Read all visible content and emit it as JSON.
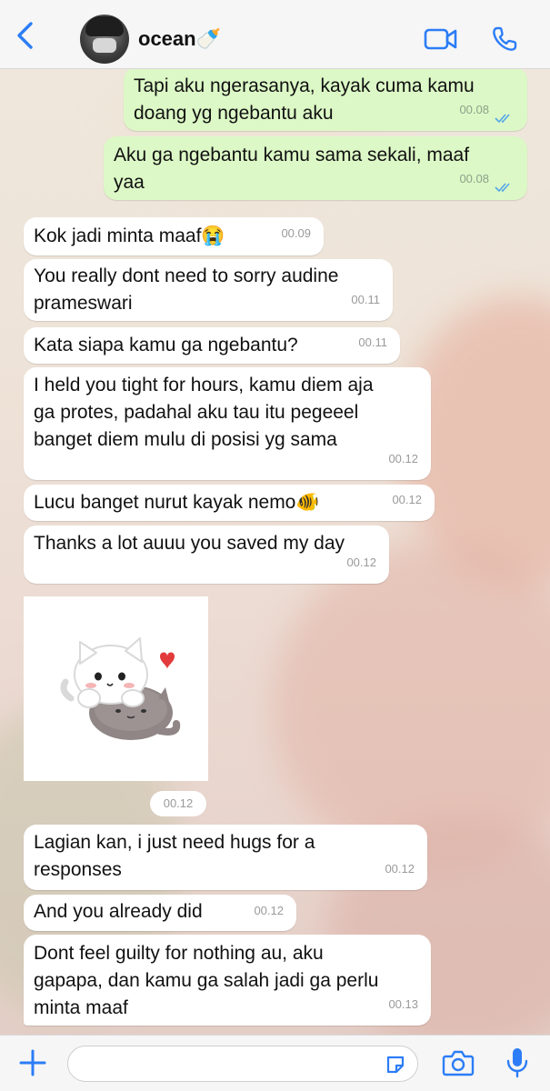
{
  "header": {
    "contact_name": "ocean🍼",
    "avatar": "profile-photo",
    "accent_color": "#2c7df6"
  },
  "messages": [
    {
      "dir": "out",
      "text_lines": [
        "Tapi aku ngerasanya, kayak cuma kamu",
        "doang yg ngebantu aku"
      ],
      "time": "00.08",
      "read": true
    },
    {
      "dir": "out",
      "text_lines": [
        "Aku ga ngebantu kamu sama sekali, maaf",
        "yaa"
      ],
      "time": "00.08",
      "read": true
    },
    {
      "dir": "in",
      "text_lines": [
        "Kok jadi minta maaf😭"
      ],
      "time": "00.09"
    },
    {
      "dir": "in",
      "text_lines": [
        "You really dont need to sorry audine",
        "prameswari"
      ],
      "time": "00.11"
    },
    {
      "dir": "in",
      "text_lines": [
        "Kata siapa kamu ga ngebantu?"
      ],
      "time": "00.11"
    },
    {
      "dir": "in",
      "text_lines": [
        "I held you tight for hours, kamu diem aja",
        "ga protes, padahal aku tau itu pegeeel",
        "banget diem mulu di posisi yg sama"
      ],
      "time": "00.12"
    },
    {
      "dir": "in",
      "text_lines": [
        "Lucu banget nurut kayak nemo🐠"
      ],
      "time": "00.12"
    },
    {
      "dir": "in",
      "text_lines": [
        "Thanks a lot auuu you saved my day"
      ],
      "time": "00.12"
    },
    {
      "dir": "in",
      "type": "sticker",
      "sticker": "hugging-cats-sticker",
      "time": "00.12"
    },
    {
      "dir": "in",
      "text_lines": [
        "Lagian kan, i just need hugs for a",
        "responses"
      ],
      "time": "00.12"
    },
    {
      "dir": "in",
      "text_lines": [
        "And you already did"
      ],
      "time": "00.12"
    },
    {
      "dir": "in",
      "text_lines": [
        "Dont feel guilty for nothing au, aku",
        "gapapa, dan kamu ga salah jadi ga perlu",
        "minta maaf"
      ],
      "time": "00.13"
    }
  ],
  "composer": {
    "placeholder": "",
    "icons": [
      "plus-icon",
      "sticker-icon",
      "camera-icon",
      "mic-icon"
    ]
  },
  "colors": {
    "outgoing_bubble": "#dcf8c6",
    "incoming_bubble": "#ffffff",
    "read_ticks": "#53a6e8"
  }
}
